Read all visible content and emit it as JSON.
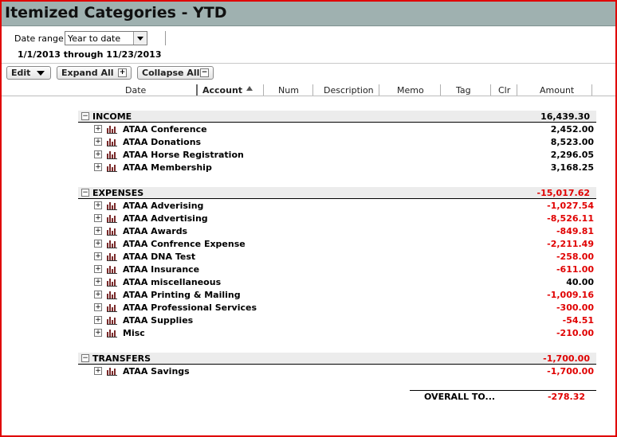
{
  "window": {
    "title": "Itemized Categories - YTD"
  },
  "date_range": {
    "label": "Date range:",
    "value": "Year to date",
    "text": "1/1/2013 through 11/23/2013"
  },
  "toolbar": {
    "edit_label": "Edit",
    "expand_label": "Expand All",
    "collapse_label": "Collapse All"
  },
  "columns": [
    "Date",
    "Account",
    "Num",
    "Description",
    "Memo",
    "Tag",
    "Clr",
    "Amount"
  ],
  "income": {
    "label": "INCOME",
    "total": "16,439.30",
    "items": [
      {
        "name": "ATAA Conference",
        "amount": "2,452.00"
      },
      {
        "name": "ATAA Donations",
        "amount": "8,523.00"
      },
      {
        "name": "ATAA Horse Registration",
        "amount": "2,296.05"
      },
      {
        "name": "ATAA Membership",
        "amount": "3,168.25"
      }
    ]
  },
  "expenses": {
    "label": "EXPENSES",
    "total": "-15,017.62",
    "items": [
      {
        "name": "ATAA Adverising",
        "amount": "-1,027.54"
      },
      {
        "name": "ATAA Advertising",
        "amount": "-8,526.11"
      },
      {
        "name": "ATAA Awards",
        "amount": "-849.81"
      },
      {
        "name": "ATAA Confrence Expense",
        "amount": "-2,211.49"
      },
      {
        "name": "ATAA DNA Test",
        "amount": "-258.00"
      },
      {
        "name": "ATAA Insurance",
        "amount": "-611.00"
      },
      {
        "name": "ATAA miscellaneous",
        "amount": "40.00"
      },
      {
        "name": "ATAA Printing & Mailing",
        "amount": "-1,009.16"
      },
      {
        "name": "ATAA Professional Services",
        "amount": "-300.00"
      },
      {
        "name": "ATAA Supplies",
        "amount": "-54.51"
      },
      {
        "name": "Misc",
        "amount": "-210.00"
      }
    ]
  },
  "transfers": {
    "label": "TRANSFERS",
    "total": "-1,700.00",
    "items": [
      {
        "name": "ATAA Savings",
        "amount": "-1,700.00"
      }
    ]
  },
  "overall": {
    "label": "OVERALL TO...",
    "amount": "-278.32"
  },
  "icons": {
    "expand": "plus-box-icon",
    "collapse": "minus-box-icon",
    "category": "bar-chart-icon",
    "dropdown": "dropdown-arrow-icon"
  },
  "colors": {
    "negative": "#e00000",
    "title_bar": "#9fb1b0",
    "frame_border": "#e00000"
  }
}
